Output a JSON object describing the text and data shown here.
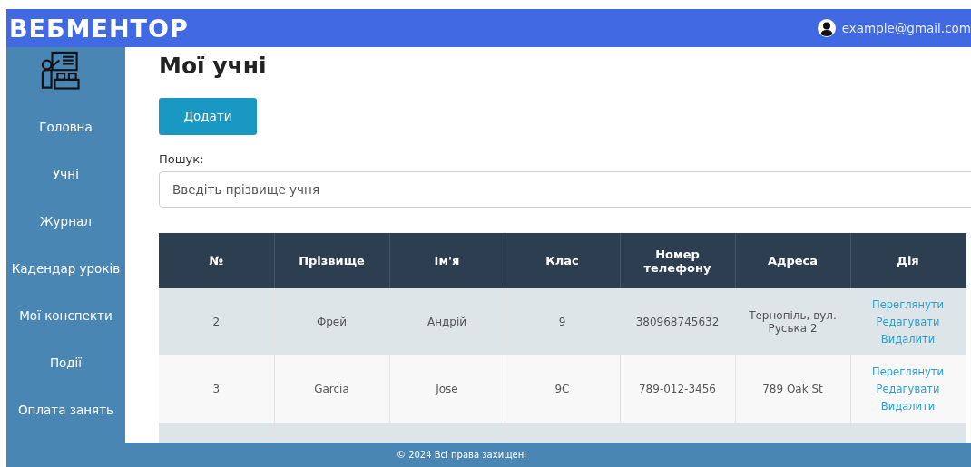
{
  "header": {
    "logo": "ВЕБМЕНТОР",
    "user_email": "example@gmail.com"
  },
  "sidebar": {
    "items": [
      {
        "label": "Головна"
      },
      {
        "label": "Учні"
      },
      {
        "label": "Журнал"
      },
      {
        "label": "Кадендар уроків"
      },
      {
        "label": "Мої конспекти"
      },
      {
        "label": "Події"
      },
      {
        "label": "Оплата занять"
      }
    ]
  },
  "page_title": "Мої учні",
  "add_button": "Додати",
  "search": {
    "label": "Пошук:",
    "placeholder": "Введіть прізвище учня"
  },
  "table": {
    "columns": [
      "№",
      "Прізвище",
      "Ім'я",
      "Клас",
      "Номер телефону",
      "Адреса",
      "Дія"
    ],
    "rows": [
      {
        "cells": [
          "2",
          "Фрей",
          "Андрій",
          "9",
          "380968745632",
          "Тернопіль, вул. Руська 2"
        ],
        "actions": [
          "Переглянути",
          "Редагувати",
          "Видалити"
        ]
      },
      {
        "cells": [
          "3",
          "Garcia",
          "Jose",
          "9C",
          "789-012-3456",
          "789 Oak St"
        ],
        "actions": [
          "Переглянути",
          "Редагувати",
          "Видалити"
        ]
      },
      {
        "cells": [],
        "actions": []
      }
    ]
  },
  "footer": "© 2024 Всі права захищені"
}
